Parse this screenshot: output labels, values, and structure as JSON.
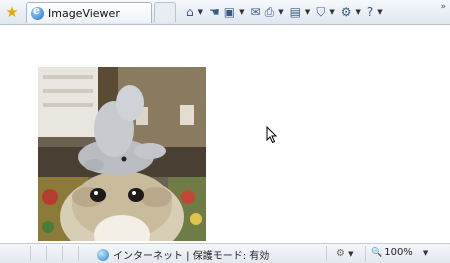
{
  "toolbar": {
    "tab_title": "ImageViewer",
    "tools": [
      {
        "icon": "home-icon",
        "glyph": "⌂",
        "has_menu": true
      },
      {
        "icon": "hand-icon",
        "glyph": "☚",
        "has_menu": false
      },
      {
        "icon": "feeds-icon",
        "glyph": "▣",
        "has_menu": true
      },
      {
        "icon": "mail-icon",
        "glyph": "✉",
        "has_menu": false
      },
      {
        "icon": "print-icon",
        "glyph": "⎙",
        "has_menu": true
      },
      {
        "icon": "page-icon",
        "glyph": "▤",
        "has_menu": true
      },
      {
        "icon": "safety-icon",
        "glyph": "⛉",
        "has_menu": true
      },
      {
        "icon": "tools-gear-icon",
        "glyph": "⚙",
        "has_menu": true
      },
      {
        "icon": "help-icon",
        "glyph": "?",
        "has_menu": true
      }
    ],
    "more": "»"
  },
  "statusbar": {
    "zone_text": "インターネット | 保護モード: 有効",
    "zoom": "100%",
    "zoom_symbol": "🔍"
  },
  "colors": {
    "accent": "#1f6fc0",
    "toolbar_bg": "#e6ecf3"
  }
}
